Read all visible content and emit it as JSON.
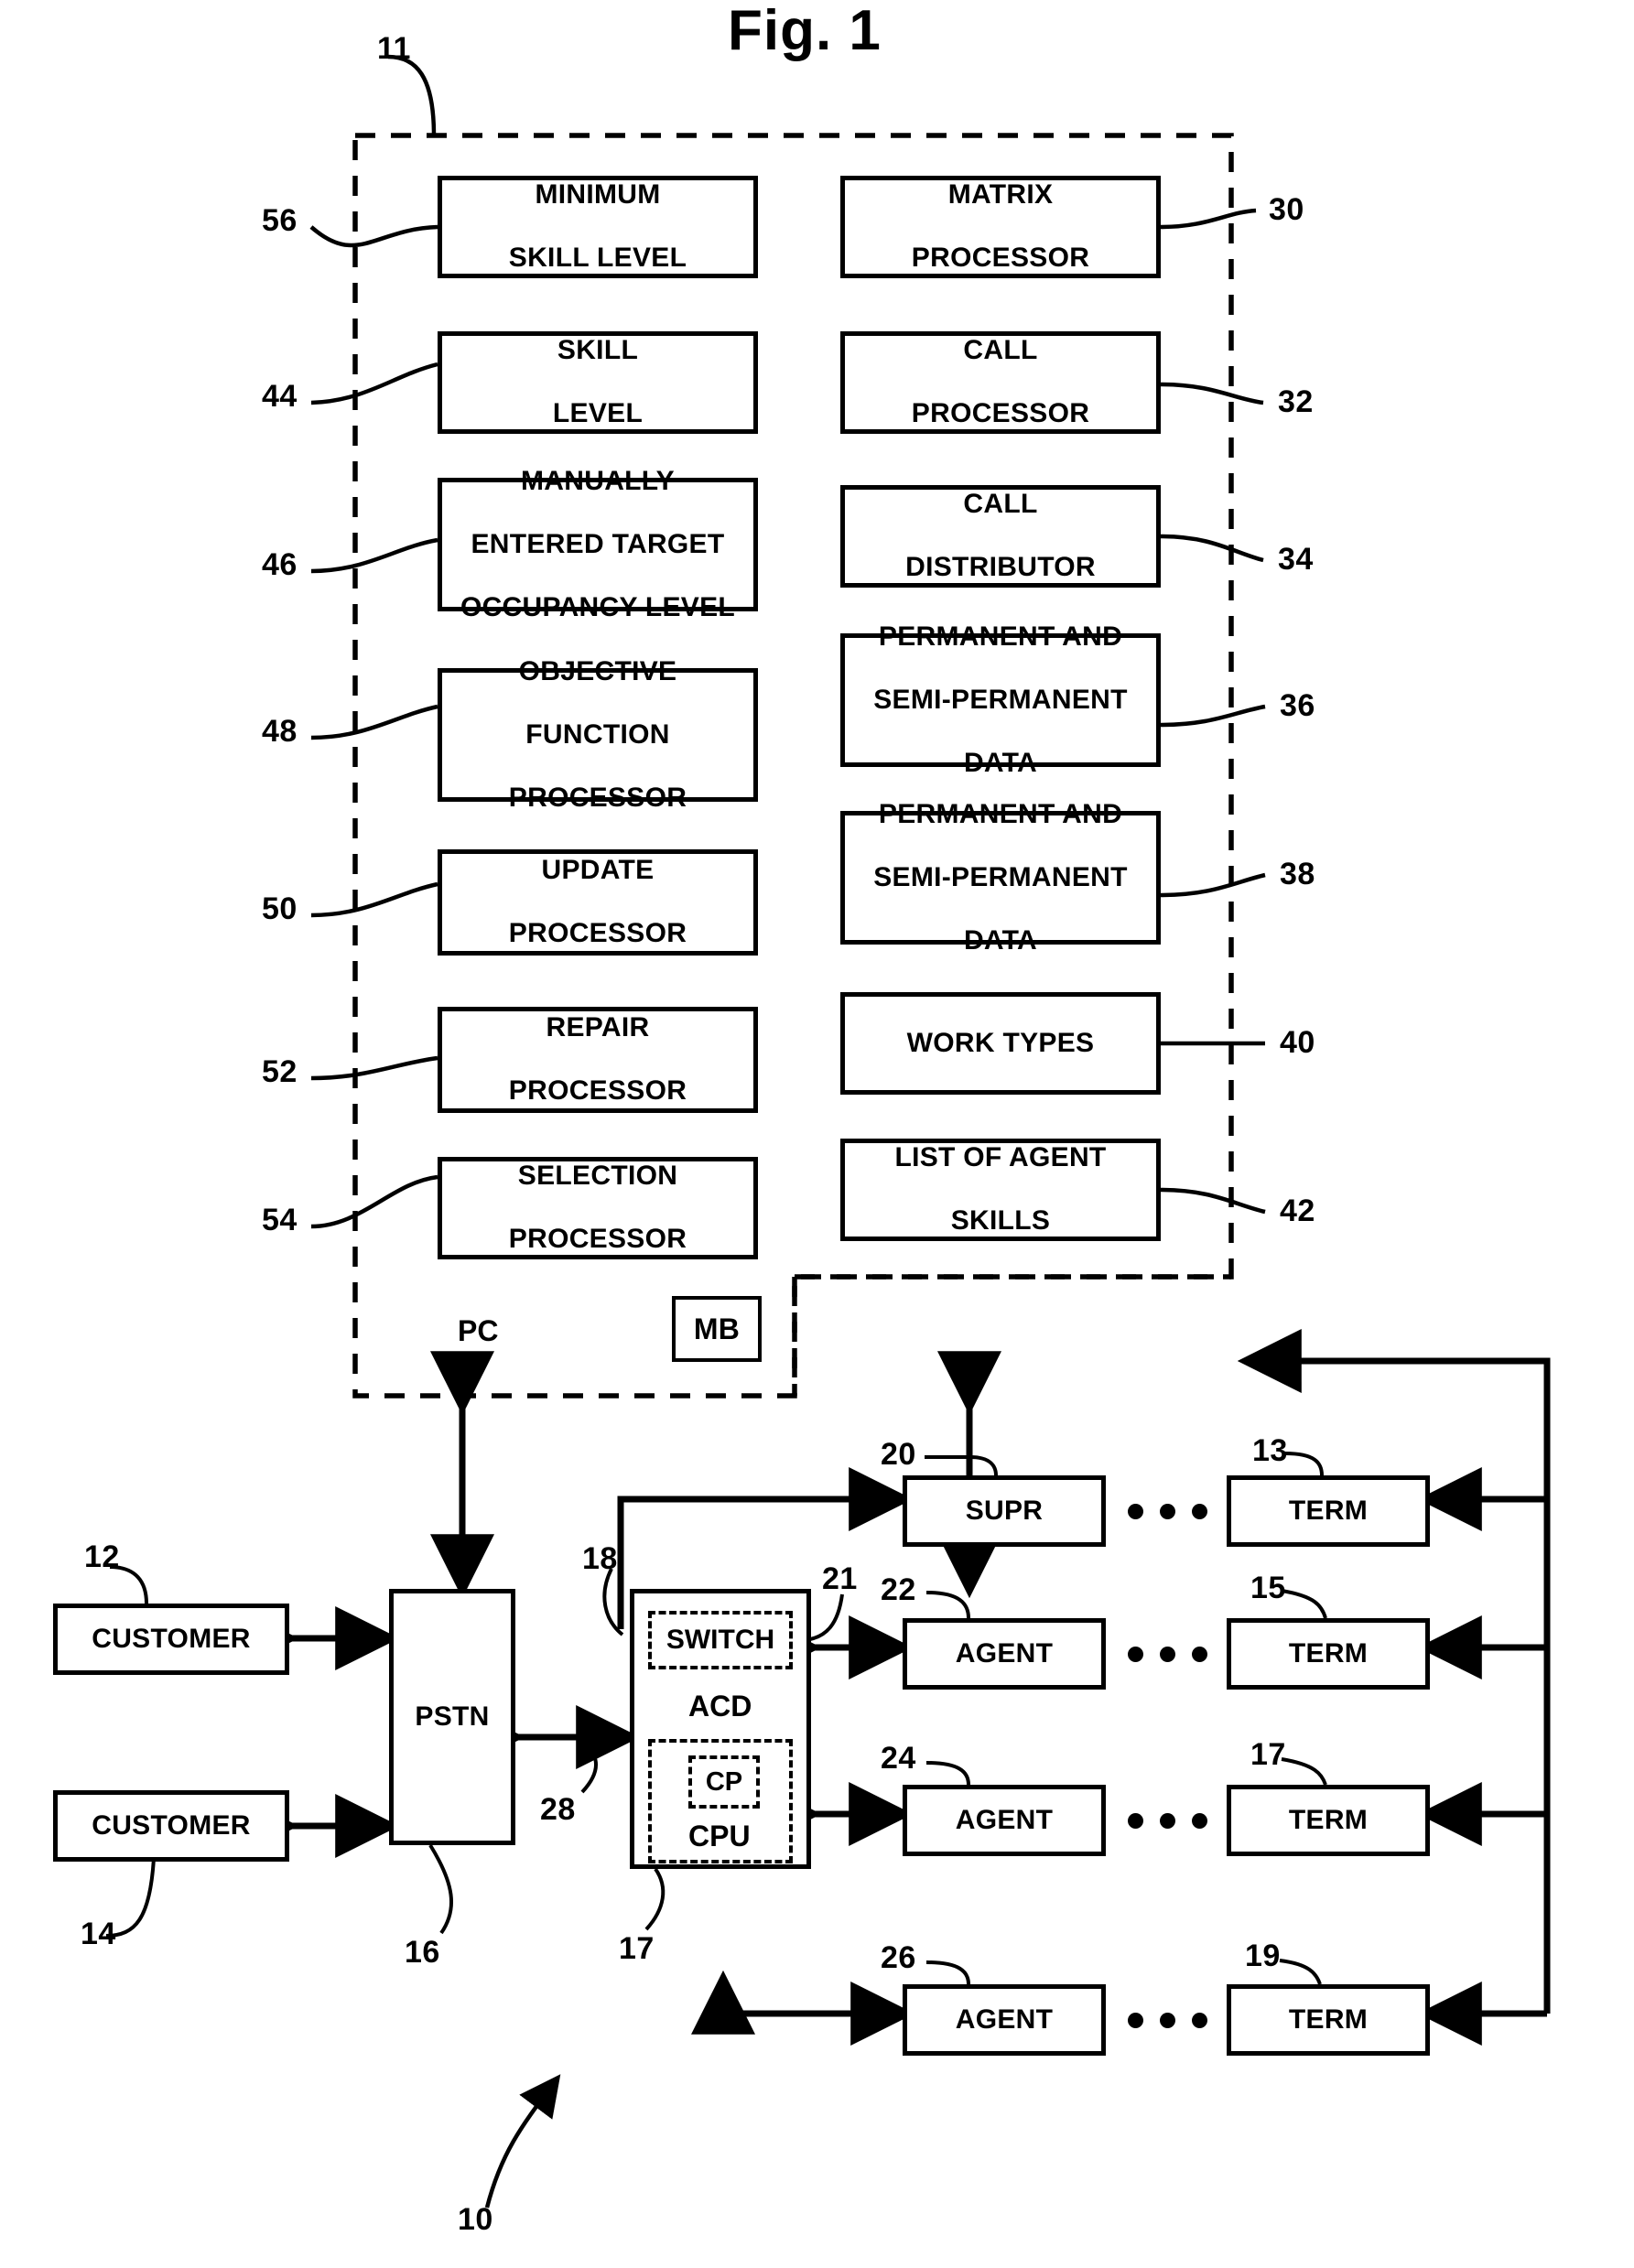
{
  "figure": {
    "title": "Fig. 1",
    "overall_ref": "10"
  },
  "pc_enclosure": {
    "ref": "11",
    "label": "PC",
    "mb_label": "MB"
  },
  "left_column": [
    {
      "ref": "56",
      "lines": [
        "MINIMUM",
        "SKILL LEVEL"
      ]
    },
    {
      "ref": "44",
      "lines": [
        "SKILL",
        "LEVEL"
      ]
    },
    {
      "ref": "46",
      "lines": [
        "MANUALLY",
        "ENTERED TARGET",
        "OCCUPANCY LEVEL"
      ]
    },
    {
      "ref": "48",
      "lines": [
        "OBJECTIVE",
        "FUNCTION",
        "PROCESSOR"
      ]
    },
    {
      "ref": "50",
      "lines": [
        "UPDATE",
        "PROCESSOR"
      ]
    },
    {
      "ref": "52",
      "lines": [
        "REPAIR",
        "PROCESSOR"
      ]
    },
    {
      "ref": "54",
      "lines": [
        "SELECTION",
        "PROCESSOR"
      ]
    }
  ],
  "right_column": [
    {
      "ref": "30",
      "lines": [
        "MATRIX",
        "PROCESSOR"
      ]
    },
    {
      "ref": "32",
      "lines": [
        "CALL",
        "PROCESSOR"
      ]
    },
    {
      "ref": "34",
      "lines": [
        "CALL",
        "DISTRIBUTOR"
      ]
    },
    {
      "ref": "36",
      "lines": [
        "PERMANENT AND",
        "SEMI-PERMANENT",
        "DATA"
      ]
    },
    {
      "ref": "38",
      "lines": [
        "PERMANENT AND",
        "SEMI-PERMANENT",
        "DATA"
      ]
    },
    {
      "ref": "40",
      "lines": [
        "WORK TYPES"
      ]
    },
    {
      "ref": "42",
      "lines": [
        "LIST OF AGENT",
        "SKILLS"
      ]
    }
  ],
  "network": {
    "customers": [
      {
        "ref": "12",
        "label": "CUSTOMER"
      },
      {
        "ref": "14",
        "label": "CUSTOMER"
      }
    ],
    "pstn": {
      "ref": "16",
      "label": "PSTN"
    },
    "trunk_ref": "28",
    "acd": {
      "ref": "18",
      "label": "ACD",
      "switch": {
        "ref": "21",
        "label": "SWITCH"
      },
      "cpu": {
        "ref": "17",
        "label": "CPU",
        "cp_label": "CP"
      }
    },
    "rows": [
      {
        "left": {
          "ref": "20",
          "label": "SUPR"
        },
        "right": {
          "ref": "13",
          "label": "TERM"
        }
      },
      {
        "left": {
          "ref": "22",
          "label": "AGENT"
        },
        "right": {
          "ref": "15",
          "label": "TERM"
        }
      },
      {
        "left": {
          "ref": "24",
          "label": "AGENT"
        },
        "right": {
          "ref": "17",
          "label": "TERM"
        }
      },
      {
        "left": {
          "ref": "26",
          "label": "AGENT"
        },
        "right": {
          "ref": "19",
          "label": "TERM"
        }
      }
    ]
  }
}
